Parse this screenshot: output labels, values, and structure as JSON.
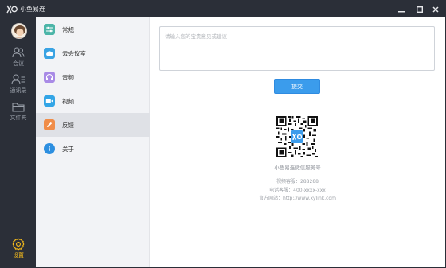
{
  "window": {
    "title": "小鱼易连"
  },
  "rail": {
    "items": [
      {
        "label": "会议",
        "icon": "people-icon"
      },
      {
        "label": "通讯录",
        "icon": "contacts-icon"
      },
      {
        "label": "文件夹",
        "icon": "folder-icon"
      }
    ],
    "settings": {
      "label": "设置",
      "icon": "gear-icon"
    }
  },
  "menu": {
    "items": [
      {
        "label": "常规",
        "icon": "sliders-icon",
        "color": "#4cb5a8"
      },
      {
        "label": "云会议室",
        "icon": "cloud-icon",
        "color": "#3aa3e3"
      },
      {
        "label": "音频",
        "icon": "headphones-icon",
        "color": "#a98be6"
      },
      {
        "label": "视频",
        "icon": "video-camera-icon",
        "color": "#33a5e6"
      },
      {
        "label": "反馈",
        "icon": "pencil-icon",
        "color": "#f08d49"
      },
      {
        "label": "关于",
        "icon": "info-icon",
        "color": "#2d8fe0"
      }
    ],
    "active_index": 4
  },
  "feedback": {
    "placeholder": "请输入您的宝贵意见或建议",
    "value": "",
    "submit_label": "提交"
  },
  "qr": {
    "label": "小鱼易连微信服务号"
  },
  "contact": {
    "video_support": "视频客服：288288",
    "phone_support": "电话客服：400-xxxx-xxx",
    "website": "官方网站：http://www.xylink.com"
  },
  "colors": {
    "dark": "#2b2f38",
    "accent": "#3b9cec",
    "active_rail": "#ffc21a"
  }
}
